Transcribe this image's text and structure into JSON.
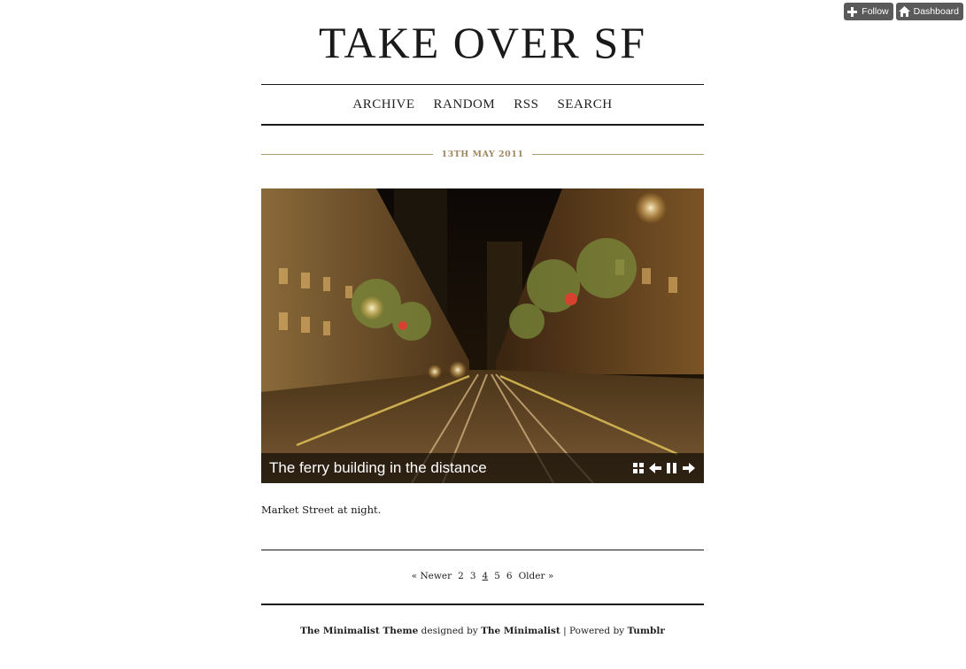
{
  "toolbar": {
    "follow_label": "Follow",
    "dashboard_label": "Dashboard"
  },
  "blog": {
    "title": "TAKE OVER SF"
  },
  "nav": {
    "items": [
      "ARCHIVE",
      "RANDOM",
      "RSS",
      "SEARCH"
    ]
  },
  "post": {
    "date": "13TH MAY 2011",
    "caption": "The ferry building in the distance",
    "body": "Market Street at night."
  },
  "slideshow_controls": [
    "grid-icon",
    "prev-arrow-icon",
    "pause-icon",
    "next-arrow-icon"
  ],
  "pagination": {
    "newer": "« Newer",
    "pages": [
      "2",
      "3",
      "4",
      "5",
      "6"
    ],
    "current": "4",
    "older": "Older »"
  },
  "footer": {
    "theme": "The Minimalist Theme",
    "designed_by": "designed by",
    "designer": "The Minimalist",
    "separator": "|",
    "powered_by": "Powered by",
    "platform": "Tumblr"
  },
  "colors": {
    "accent": "#a08660",
    "rule": "#1a1a1a",
    "toolbar_bg": "#5a5a5a"
  }
}
